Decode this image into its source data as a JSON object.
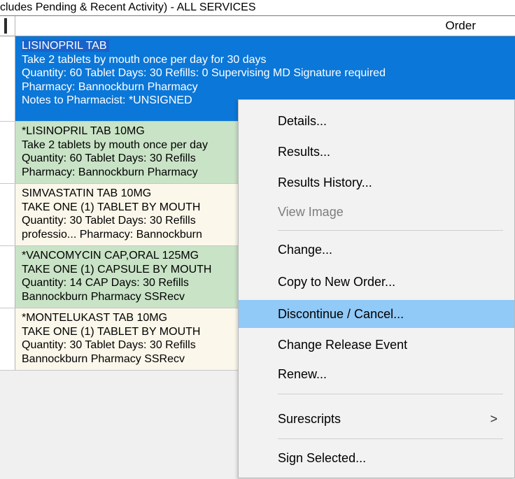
{
  "title": "cludes Pending & Recent Activity) - ALL SERVICES",
  "header": {
    "order_label": "Order"
  },
  "rows": [
    {
      "lines": [
        "LISINOPRIL TAB",
        "Take 2 tablets by mouth once per day for 30 days",
        "Quantity: 60 Tablet Days: 30 Refills: 0 Supervising MD Signature required",
        "Pharmacy: Bannockburn Pharmacy",
        "Notes to Pharmacist:  *UNSIGNED"
      ]
    },
    {
      "lines": [
        "*LISINOPRIL TAB  10MG",
        "Take 2 tablets by mouth once per day",
        "Quantity: 60 Tablet Days: 30 Refills",
        "Pharmacy: Bannockburn Pharmacy"
      ]
    },
    {
      "lines": [
        "SIMVASTATIN TAB  10MG",
        "TAKE ONE (1) TABLET BY MOUTH",
        "Quantity: 30 Tablet Days: 30 Refills",
        "professio... Pharmacy: Bannockburn"
      ]
    },
    {
      "lines": [
        "*VANCOMYCIN CAP,ORAL  125MG",
        "TAKE ONE (1) CAPSULE BY MOUTH",
        "Quantity: 14 CAP Days: 30 Refills",
        "Bannockburn Pharmacy SSRecv"
      ]
    },
    {
      "lines": [
        "*MONTELUKAST TAB  10MG",
        "TAKE ONE (1) TABLET BY MOUTH",
        "Quantity: 30 Tablet Days: 30 Refills",
        "Bannockburn Pharmacy SSRecv"
      ]
    }
  ],
  "menu": {
    "items": [
      {
        "label": "Details...",
        "enabled": true
      },
      {
        "label": "Results...",
        "enabled": true
      },
      {
        "label": "Results History...",
        "enabled": true
      },
      {
        "label": "View Image",
        "enabled": false
      },
      {
        "label": "Change...",
        "enabled": true
      },
      {
        "label": "Copy to New Order...",
        "enabled": true
      },
      {
        "label": "Discontinue / Cancel...",
        "enabled": true,
        "highlighted": true
      },
      {
        "label": "Change Release Event",
        "enabled": true
      },
      {
        "label": "Renew...",
        "enabled": true
      },
      {
        "label": "Surescripts",
        "enabled": true,
        "submenu": true
      },
      {
        "label": "Sign Selected...",
        "enabled": true
      }
    ],
    "submenu_arrow": ">"
  }
}
